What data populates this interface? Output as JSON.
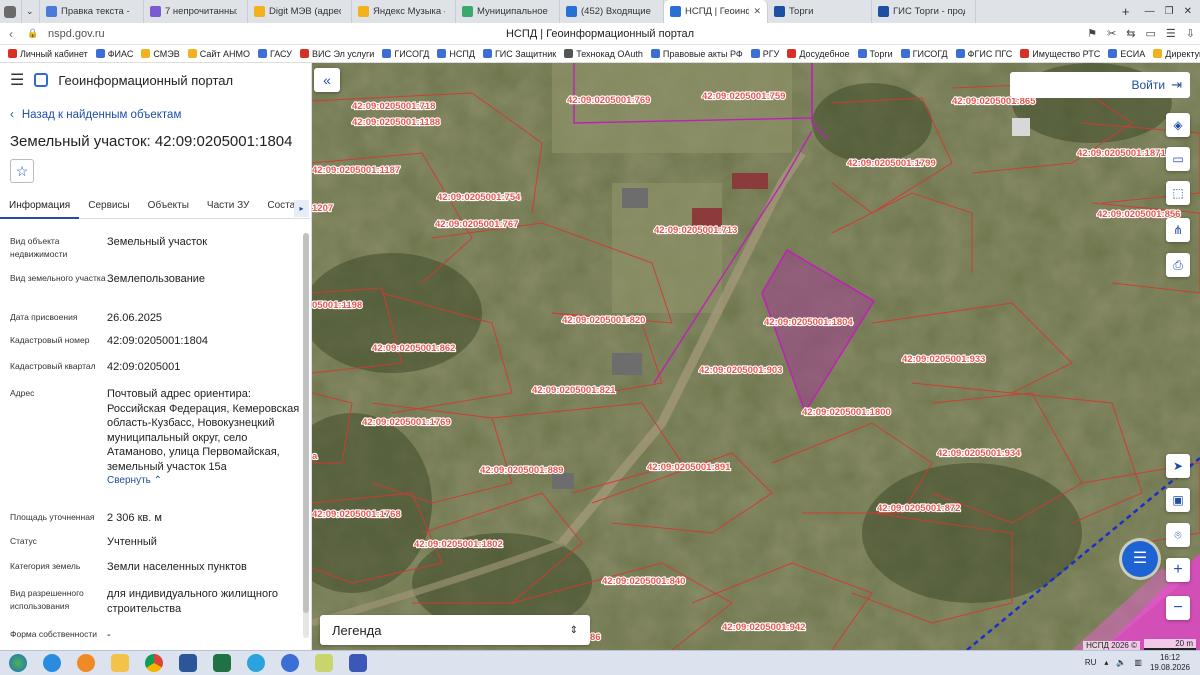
{
  "browser": {
    "tabs": [
      {
        "label": "Правка текста - Deep",
        "color": "#4b7bd8"
      },
      {
        "label": "7 непрочитанных чат",
        "color": "#7a5bd2"
      },
      {
        "label": "Digit МЭВ (адрес техн",
        "color": "#f2b21e"
      },
      {
        "label": "Яндекс Музыка — соб",
        "color": "#f2b21e"
      },
      {
        "label": "Муниципальное обра",
        "color": "#3aa96b"
      },
      {
        "label": "(452) Входящие - Поч",
        "color": "#2a6fd6"
      },
      {
        "label": "НСПД | Геоинформац",
        "color": "#2a6fd6"
      },
      {
        "label": "Торги",
        "color": "#1f4fa3"
      },
      {
        "label": "ГИС Торги - продажа",
        "color": "#1f4fa3"
      }
    ],
    "url": "nspd.gov.ru",
    "page_title": "НСПД | Геоинформационный портал",
    "bookmarks": [
      "Личный кабинет",
      "ФИАС",
      "СМЭВ",
      "Сайт АНМО",
      "ГАСУ",
      "ВИС Эл услуги",
      "ГИСОГД",
      "НСПД",
      "ГИС Защитник",
      "Технокад OAuth",
      "Правовые акты РФ",
      "РГУ",
      "Досудебное",
      "Торги",
      "ГИСОГД",
      "ФГИС ПГС",
      "Имущество РТС",
      "ЕСИА",
      "Директум РХ"
    ]
  },
  "panel": {
    "app_title": "Геоинформационный портал",
    "back_link": "Назад к найденным объектам",
    "title": "Земельный участок: 42:09:0205001:1804",
    "tabs": [
      "Информация",
      "Сервисы",
      "Объекты",
      "Части ЗУ",
      "Состав"
    ],
    "fields": [
      {
        "k": "Вид объекта недвижимости",
        "v": "Земельный участок"
      },
      {
        "k": "Вид земельного участка",
        "v": "Землепользование"
      },
      {
        "k": "Дата присвоения",
        "v": "26.06.2025"
      },
      {
        "k": "Кадастровый номер",
        "v": "42:09:0205001:1804"
      },
      {
        "k": "Кадастровый квартал",
        "v": "42:09:0205001"
      },
      {
        "k": "Адрес",
        "v": "Почтовый адрес ориентира: Российская Федерация, Кемеровская область-Кузбасс, Новокузнецкий муниципальный округ, село Атаманово, улица Первомайская, земельный участок 15а"
      },
      {
        "k": "Площадь уточненная",
        "v": "2 306 кв. м"
      },
      {
        "k": "Статус",
        "v": "Учтенный"
      },
      {
        "k": "Категория земель",
        "v": "Земли населенных пунктов"
      },
      {
        "k": "Вид разрешенного использования",
        "v": "для индивидуального жилищного строительства"
      },
      {
        "k": "Форма собственности",
        "v": "-"
      }
    ],
    "collapse": "Свернуть"
  },
  "map": {
    "login": "Войти",
    "legend": "Легенда",
    "copyright": "НСПД 2026 ©",
    "scale": "20 m",
    "labels": [
      "42:09:0205001:718",
      "42:09:0205001:769",
      "42:09:0205001:759",
      "42:09:0205001:865",
      "42:09:0205001:1188",
      "42:09:0205001:1799",
      "42:09:0205001:1871",
      "42:09:0205001:1187",
      "42:09:0205001:754",
      "42:09:0205001:767",
      "42:09:0205001:713",
      "42:09:0205001:856",
      "1207",
      "05001:1198",
      "42:09:0205001:820",
      "42:09:0205001:1804",
      "42:09:0205001:862",
      "42:09:0205001:903",
      "42:09:0205001:933",
      "42:09:0205001:821",
      "42:09:0205001:1800",
      "42:09:0205001:1769",
      "42:09:0205001:934",
      "42:09:0205001:889",
      "42:09:0205001:891",
      "42:09:0205001:872",
      "42:09:0205001:1768",
      "42:09:0205001:1802",
      "42:09:0205001:840",
      "42:09:0205001:942",
      "86",
      "a"
    ]
  },
  "taskbar": {
    "lang": "RU",
    "time": "16:12",
    "date": "19.08.2026"
  }
}
